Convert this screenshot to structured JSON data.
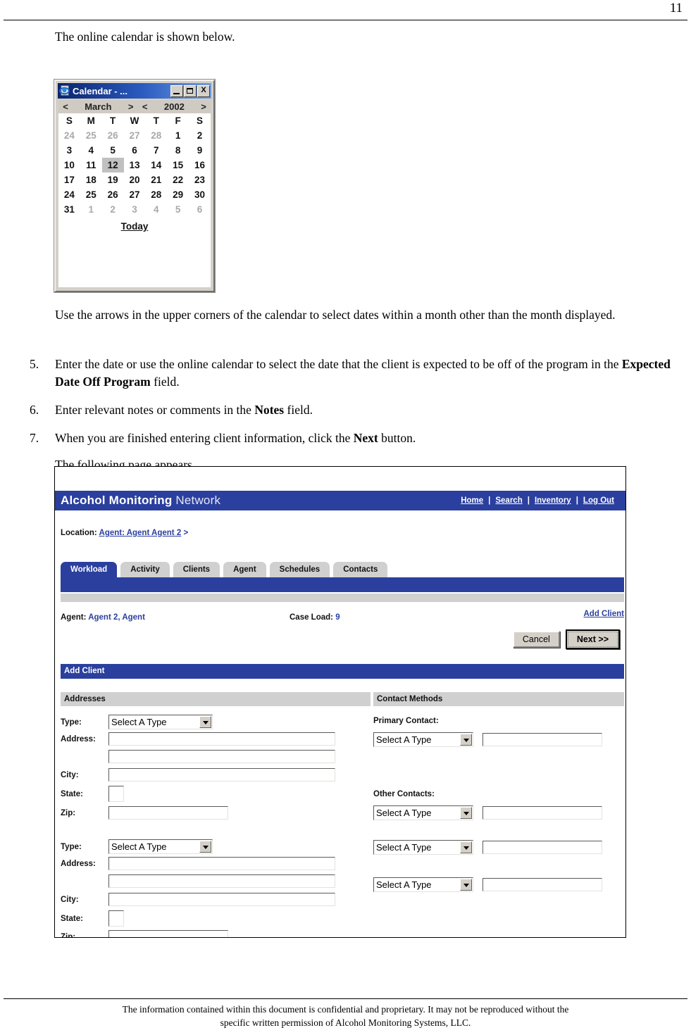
{
  "page": {
    "number": "11"
  },
  "doc": {
    "intro": "The online calendar is shown below.",
    "arrows_note": "Use the arrows in the upper corners of the calendar to select dates within a month other than the month displayed.",
    "steps": [
      {
        "num": "5.",
        "text_before": "Enter the date or use the online calendar to select the date that the client is expected to be off of the program in the ",
        "bold": "Expected Date Off Program",
        "text_after": " field."
      },
      {
        "num": "6.",
        "text_before": "Enter relevant notes or comments in the ",
        "bold": "Notes",
        "text_after": " field."
      },
      {
        "num": "7.",
        "text_before": "When you are finished entering client information, click the ",
        "bold": "Next",
        "text_after": " button."
      }
    ],
    "following_page": "The following page appears."
  },
  "calendar": {
    "title": "Calendar - ...",
    "minimize_label": "_",
    "maximize_label": "□",
    "close_label": "X",
    "prev_month_arrow": "<",
    "month": "March",
    "next_month_arrow": ">",
    "prev_year_arrow": "<",
    "year": "2002",
    "next_year_arrow": ">",
    "weekdays": [
      "S",
      "M",
      "T",
      "W",
      "T",
      "F",
      "S"
    ],
    "weeks": [
      [
        {
          "d": "24",
          "other": true
        },
        {
          "d": "25",
          "other": true
        },
        {
          "d": "26",
          "other": true
        },
        {
          "d": "27",
          "other": true
        },
        {
          "d": "28",
          "other": true
        },
        {
          "d": "1"
        },
        {
          "d": "2"
        }
      ],
      [
        {
          "d": "3"
        },
        {
          "d": "4"
        },
        {
          "d": "5"
        },
        {
          "d": "6"
        },
        {
          "d": "7"
        },
        {
          "d": "8"
        },
        {
          "d": "9"
        }
      ],
      [
        {
          "d": "10"
        },
        {
          "d": "11"
        },
        {
          "d": "12",
          "selected": true
        },
        {
          "d": "13"
        },
        {
          "d": "14"
        },
        {
          "d": "15"
        },
        {
          "d": "16"
        }
      ],
      [
        {
          "d": "17"
        },
        {
          "d": "18"
        },
        {
          "d": "19"
        },
        {
          "d": "20"
        },
        {
          "d": "21"
        },
        {
          "d": "22"
        },
        {
          "d": "23"
        }
      ],
      [
        {
          "d": "24"
        },
        {
          "d": "25"
        },
        {
          "d": "26"
        },
        {
          "d": "27"
        },
        {
          "d": "28"
        },
        {
          "d": "29"
        },
        {
          "d": "30"
        }
      ],
      [
        {
          "d": "31"
        },
        {
          "d": "1",
          "other": true
        },
        {
          "d": "2",
          "other": true
        },
        {
          "d": "3",
          "other": true
        },
        {
          "d": "4",
          "other": true
        },
        {
          "d": "5",
          "other": true
        },
        {
          "d": "6",
          "other": true
        }
      ]
    ],
    "today_label": "Today",
    "selected_day": "12"
  },
  "app": {
    "brand_strong": "Alcohol Monitoring",
    "brand_light": " Network",
    "topnav": [
      "Home",
      "Search",
      "Inventory",
      "Log Out"
    ],
    "nav_separator": "|",
    "location_label": "Location:",
    "location_link": "Agent: Agent Agent 2",
    "location_caret": ">",
    "tabs": [
      {
        "label": "Workload",
        "active": true
      },
      {
        "label": "Activity",
        "active": false
      },
      {
        "label": "Clients",
        "active": false
      },
      {
        "label": "Agent",
        "active": false
      },
      {
        "label": "Schedules",
        "active": false
      },
      {
        "label": "Contacts",
        "active": false
      }
    ],
    "agent_label": "Agent:",
    "agent_value": "Agent 2, Agent",
    "caseload_label": "Case Load:",
    "caseload_value": "9",
    "add_client_link": "Add Client",
    "cancel_button": "Cancel",
    "next_button": "Next >>",
    "section_title": "Add Client",
    "addresses_header": "Addresses",
    "contacts_header": "Contact Methods",
    "address_block": {
      "type_label": "Type:",
      "type_value": "Select A Type",
      "address_label": "Address:",
      "address_line1": "",
      "address_line2": "",
      "city_label": "City:",
      "city_value": "",
      "state_label": "State:",
      "state_value": "",
      "zip_label": "Zip:",
      "zip_value": ""
    },
    "primary_contact_label": "Primary Contact:",
    "other_contacts_label": "Other Contacts:",
    "contact_type_value": "Select A Type",
    "contact_value": "",
    "colors": {
      "brand_blue": "#2b3f9e",
      "gray_bar": "#d0d0d0",
      "link_blue": "#2b3f9e"
    }
  },
  "footer": {
    "line1": "The information contained within this document is confidential and proprietary. It may not be reproduced without the",
    "line2": "specific written permission of Alcohol Monitoring Systems, LLC."
  }
}
